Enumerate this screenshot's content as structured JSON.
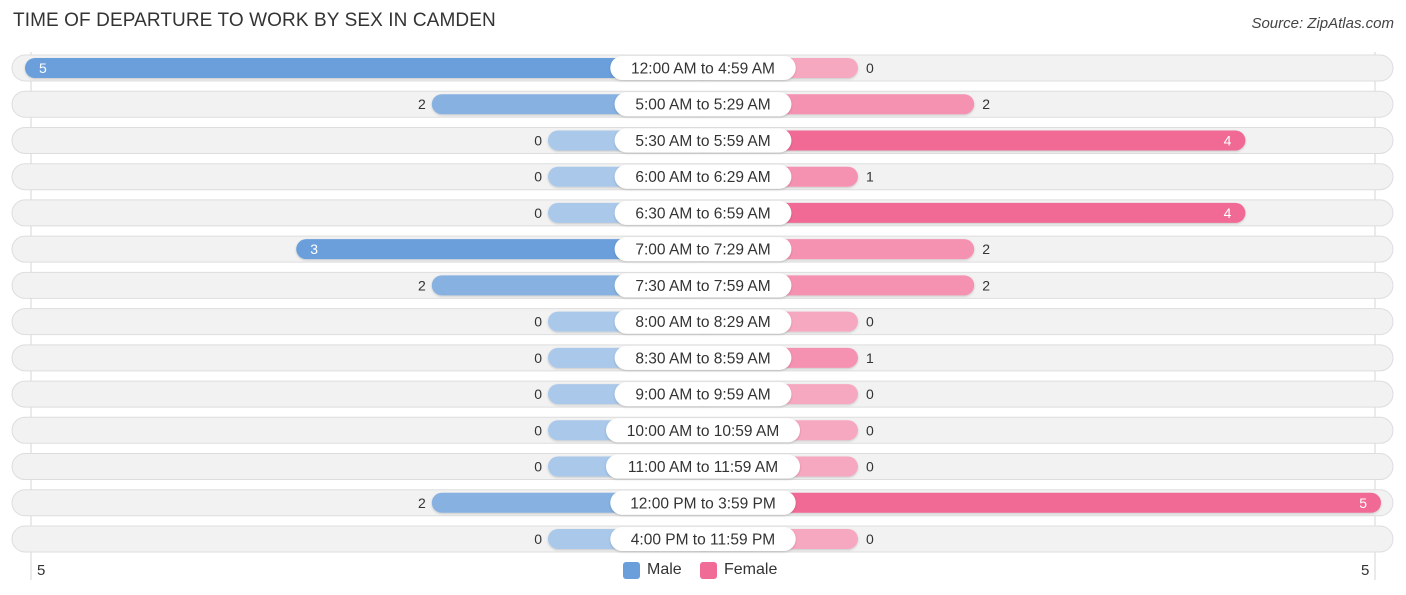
{
  "header": {
    "title": "TIME OF DEPARTURE TO WORK BY SEX IN CAMDEN",
    "source": "Source: ZipAtlas.com"
  },
  "colors": {
    "male": "#6a9fdb",
    "male_light": "#a9c8ea",
    "female": "#f06b95",
    "female_light": "#f7a8c1",
    "row_bg": "#f2f2f2",
    "row_border": "#dddddd"
  },
  "chart_data": {
    "type": "bar",
    "orientation": "horizontal-diverging",
    "title": "TIME OF DEPARTURE TO WORK BY SEX IN CAMDEN",
    "categories": [
      "12:00 AM to 4:59 AM",
      "5:00 AM to 5:29 AM",
      "5:30 AM to 5:59 AM",
      "6:00 AM to 6:29 AM",
      "6:30 AM to 6:59 AM",
      "7:00 AM to 7:29 AM",
      "7:30 AM to 7:59 AM",
      "8:00 AM to 8:29 AM",
      "8:30 AM to 8:59 AM",
      "9:00 AM to 9:59 AM",
      "10:00 AM to 10:59 AM",
      "11:00 AM to 11:59 AM",
      "12:00 PM to 3:59 PM",
      "4:00 PM to 11:59 PM"
    ],
    "series": [
      {
        "name": "Male",
        "values": [
          5,
          2,
          0,
          0,
          0,
          3,
          2,
          0,
          0,
          0,
          0,
          0,
          2,
          0
        ]
      },
      {
        "name": "Female",
        "values": [
          0,
          2,
          4,
          1,
          4,
          2,
          2,
          0,
          1,
          0,
          0,
          0,
          5,
          0
        ]
      }
    ],
    "axis": {
      "left_max_label": "5",
      "right_max_label": "5",
      "range": [
        0,
        5
      ]
    },
    "legend": {
      "placement": "bottom-center",
      "entries": [
        "Male",
        "Female"
      ]
    },
    "grid": false
  }
}
